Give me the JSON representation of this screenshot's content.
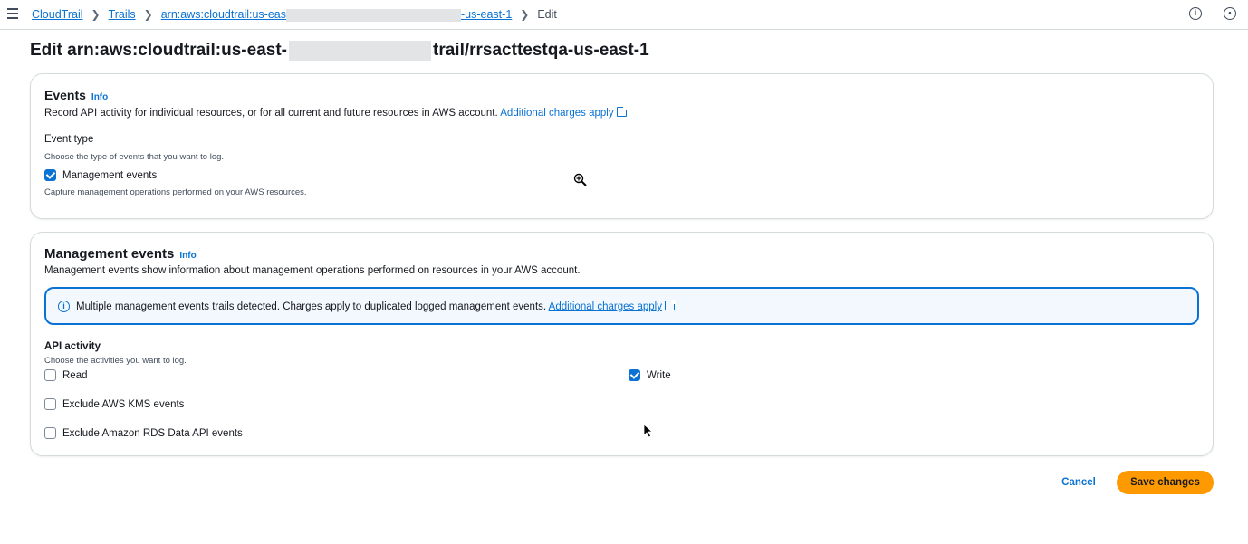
{
  "breadcrumb": {
    "items": [
      "CloudTrail",
      "Trails"
    ],
    "arn_prefix": "arn:aws:cloudtrail:us-eas",
    "arn_suffix": "-us-east-1",
    "current": "Edit"
  },
  "page": {
    "title_prefix": "Edit arn:aws:cloudtrail:us-east-",
    "title_suffix": "trail/rrsacttestqa-us-east-1"
  },
  "events_panel": {
    "heading": "Events",
    "info": "Info",
    "description": "Record API activity for individual resources, or for all current and future resources in AWS account.",
    "charges_link": "Additional charges apply",
    "event_type_label": "Event type",
    "event_type_hint": "Choose the type of events that you want to log.",
    "management_events": {
      "label": "Management events",
      "checked": true
    },
    "management_events_hint": "Capture management operations performed on your AWS resources."
  },
  "management_panel": {
    "heading": "Management events",
    "info": "Info",
    "description": "Management events show information about management operations performed on resources in your AWS account.",
    "alert_text": "Multiple management events trails detected. Charges apply to duplicated logged management events.",
    "alert_link": "Additional charges apply",
    "api_activity_label": "API activity",
    "api_activity_hint": "Choose the activities you want to log.",
    "read": {
      "label": "Read",
      "checked": false
    },
    "write": {
      "label": "Write",
      "checked": true
    },
    "exclude_kms": {
      "label": "Exclude AWS KMS events",
      "checked": false
    },
    "exclude_rds": {
      "label": "Exclude Amazon RDS Data API events",
      "checked": false
    }
  },
  "actions": {
    "cancel": "Cancel",
    "save": "Save changes"
  },
  "colors": {
    "link": "#0972d3",
    "primary_button": "#ff9900",
    "alert_bg": "#f2f8fd"
  }
}
